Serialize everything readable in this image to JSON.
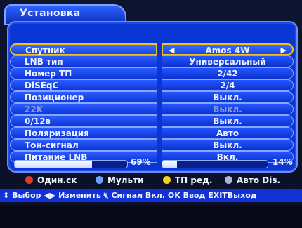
{
  "screen": {
    "title": "Установка"
  },
  "rows": [
    {
      "label": "Спутник",
      "value": "Amos  4W",
      "selected": true
    },
    {
      "label": "LNB  тип",
      "value": "Универсальный"
    },
    {
      "label": "Номер  ТП",
      "value": "2/42"
    },
    {
      "label": "DiSEqC",
      "value": "2/4"
    },
    {
      "label": "Позиционер",
      "value": "Выкл."
    },
    {
      "label": "22K",
      "value": "Выкл.",
      "disabled": true
    },
    {
      "label": "0/12в",
      "value": "Выкл."
    },
    {
      "label": "Поляризация",
      "value": "Авто"
    },
    {
      "label": "Тон-сигнал",
      "value": "Выкл."
    },
    {
      "label": "Питание  LNB",
      "value": "Вкл."
    }
  ],
  "signal": {
    "strength_pct": 69,
    "strength_label": "69%",
    "quality_pct": 14,
    "quality_label": "14%"
  },
  "legend": {
    "red": "Один.ск",
    "blue": "Мульти",
    "yellow": "ТП  ред.",
    "gray": "Авто  Dis.",
    "colors": {
      "red": "#e23a2a",
      "blue": "#6aa2ff",
      "yellow": "#f2d31a",
      "gray": "#a9b6dc"
    }
  },
  "help": {
    "select": "Выбор",
    "change": "Изменить",
    "signal": "Сигнал",
    "on": "Вкл.",
    "ok": "OK",
    "enter": "Ввод",
    "exit": "EXIT",
    "exit_label": "Выход"
  }
}
